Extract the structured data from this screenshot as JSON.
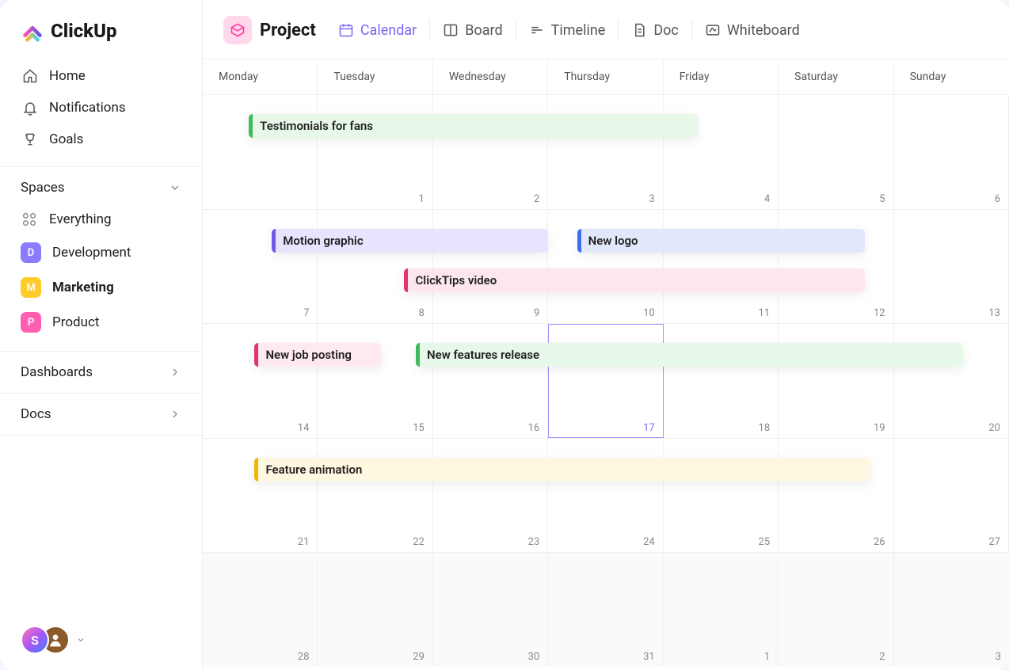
{
  "brand": "ClickUp",
  "sidebar": {
    "nav": [
      {
        "label": "Home",
        "icon": "home"
      },
      {
        "label": "Notifications",
        "icon": "bell"
      },
      {
        "label": "Goals",
        "icon": "trophy"
      }
    ],
    "spaces_label": "Spaces",
    "everything_label": "Everything",
    "spaces": [
      {
        "letter": "D",
        "label": "Development",
        "color": "#8b7cff"
      },
      {
        "letter": "M",
        "label": "Marketing",
        "color": "#ffcb2b",
        "active": true
      },
      {
        "letter": "P",
        "label": "Product",
        "color": "#ff5fb1"
      }
    ],
    "dashboards_label": "Dashboards",
    "docs_label": "Docs",
    "user_initial": "S"
  },
  "topbar": {
    "project_label": "Project",
    "views": [
      {
        "label": "Calendar",
        "icon": "calendar",
        "active": true
      },
      {
        "label": "Board",
        "icon": "board"
      },
      {
        "label": "Timeline",
        "icon": "timeline"
      },
      {
        "label": "Doc",
        "icon": "doc"
      },
      {
        "label": "Whiteboard",
        "icon": "whiteboard"
      }
    ]
  },
  "calendar": {
    "day_headers": [
      "Monday",
      "Tuesday",
      "Wednesday",
      "Thursday",
      "Friday",
      "Saturday",
      "Sunday"
    ],
    "weeks": [
      {
        "dates": [
          "",
          "1",
          "2",
          "3",
          "4",
          "5",
          "6"
        ],
        "today": -1,
        "dim": false
      },
      {
        "dates": [
          "7",
          "8",
          "9",
          "10",
          "11",
          "12",
          "13"
        ],
        "today": -1,
        "dim": false
      },
      {
        "dates": [
          "14",
          "15",
          "16",
          "17",
          "18",
          "19",
          "20"
        ],
        "today": 3,
        "dim": false
      },
      {
        "dates": [
          "21",
          "22",
          "23",
          "24",
          "25",
          "26",
          "27"
        ],
        "today": -1,
        "dim": false
      },
      {
        "dates": [
          "28",
          "29",
          "30",
          "31",
          "1",
          "2",
          "3"
        ],
        "today": -1,
        "dim": true
      }
    ],
    "cell_pct": 14.2857,
    "events": [
      {
        "week": 0,
        "row": 0,
        "start": 0.4,
        "span": 3.9,
        "label": "Testimonials for fans",
        "cls": "ev-green"
      },
      {
        "week": 1,
        "row": 0,
        "start": 0.6,
        "span": 2.4,
        "label": "Motion graphic",
        "cls": "ev-purple"
      },
      {
        "week": 1,
        "row": 0,
        "start": 3.25,
        "span": 2.5,
        "label": "New logo",
        "cls": "ev-blue"
      },
      {
        "week": 1,
        "row": 1,
        "start": 1.75,
        "span": 4.0,
        "label": "ClickTips video",
        "cls": "ev-pink"
      },
      {
        "week": 2,
        "row": 0,
        "start": 0.45,
        "span": 1.1,
        "label": "New job posting",
        "cls": "ev-pink2"
      },
      {
        "week": 2,
        "row": 0,
        "start": 1.85,
        "span": 4.75,
        "label": "New features release",
        "cls": "ev-green"
      },
      {
        "week": 3,
        "row": 0,
        "start": 0.45,
        "span": 5.35,
        "label": "Feature animation",
        "cls": "ev-yellow"
      }
    ]
  }
}
